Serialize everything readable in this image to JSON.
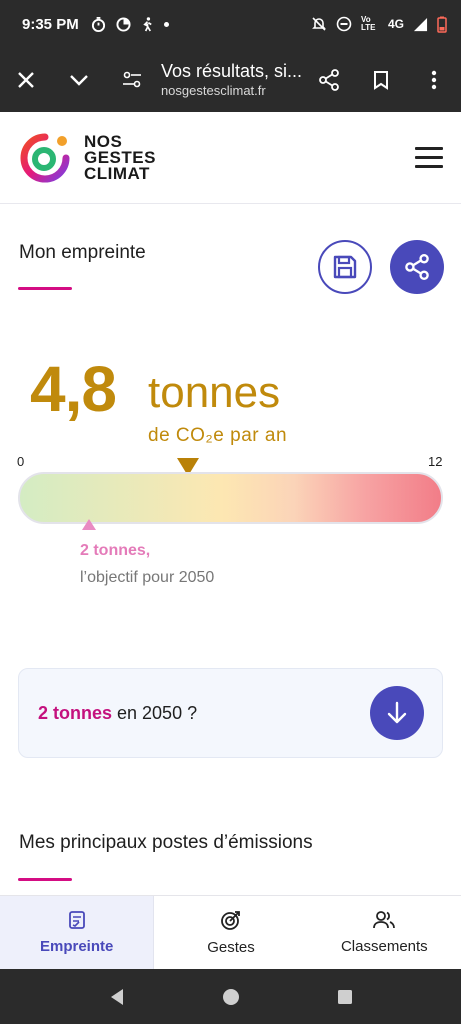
{
  "status_bar": {
    "time": "9:35 PM",
    "network": "4G",
    "volte": "Vo LTE"
  },
  "browser": {
    "page_title": "Vos résultats, si...",
    "host": "nosgestesclimat.fr"
  },
  "site": {
    "logo_lines": [
      "NOS",
      "GESTES",
      "CLIMAT"
    ]
  },
  "footprint": {
    "section_title": "Mon empreinte",
    "value": "4,8",
    "unit": "tonnes",
    "per_year": "de CO₂e par an",
    "scale_min": "0",
    "scale_max": "12",
    "current_value_tonnes": 4.8,
    "target_value_tonnes": 2,
    "target_label": "2 tonnes,",
    "target_caption": "l’objectif pour 2050"
  },
  "cta": {
    "highlight": "2 tonnes",
    "rest": " en 2050 ?"
  },
  "emissions": {
    "title": "Mes principaux postes d’émissions"
  },
  "tabs": [
    {
      "label": "Empreinte",
      "icon": "document-icon",
      "active": true
    },
    {
      "label": "Gestes",
      "icon": "target-icon",
      "active": false
    },
    {
      "label": "Classements",
      "icon": "people-icon",
      "active": false
    }
  ],
  "colors": {
    "accent": "#4949ba",
    "value_gold": "#c08a0c",
    "pink": "#d40d83",
    "target_pink": "#e47bb9"
  }
}
